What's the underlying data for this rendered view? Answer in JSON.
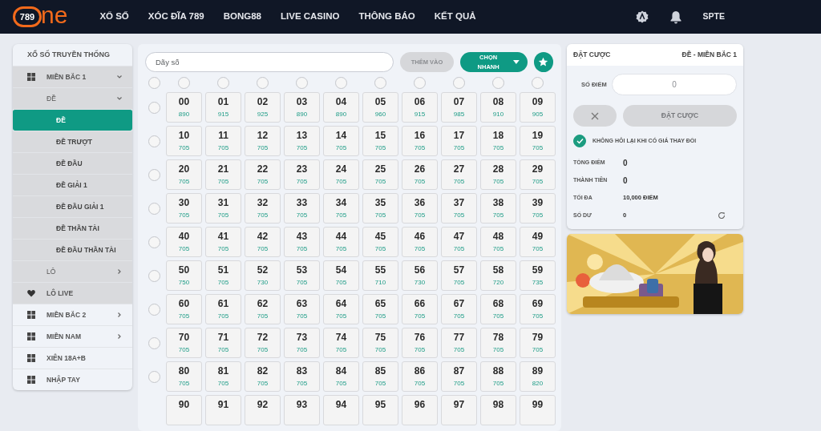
{
  "header": {
    "logo": {
      "number": "789",
      "word": "ne"
    },
    "nav": [
      {
        "label": "XỔ SỐ"
      },
      {
        "label": "XÓC ĐĨA 789"
      },
      {
        "label": "BONG88"
      },
      {
        "label": "LIVE CASINO"
      },
      {
        "label": "THÔNG BÁO"
      },
      {
        "label": "KẾT QUẢ"
      }
    ],
    "username": "SPTE"
  },
  "sidebar": {
    "title": "XỔ SỐ TRUYỀN THỐNG",
    "items": [
      {
        "label": "MIỀN BẮC 1",
        "kind": "region",
        "expanded": true,
        "selected": false,
        "children": [
          {
            "label": "ĐỀ",
            "kind": "group",
            "expanded": true,
            "selected": false,
            "children": [
              {
                "label": "ĐỀ",
                "kind": "leaf",
                "selected": true
              },
              {
                "label": "ĐỀ TRƯỢT",
                "kind": "leaf",
                "selected": false
              },
              {
                "label": "ĐỀ ĐẦU",
                "kind": "leaf",
                "selected": false
              },
              {
                "label": "ĐỀ GIẢI 1",
                "kind": "leaf",
                "selected": false
              },
              {
                "label": "ĐỀ ĐẦU GIẢI 1",
                "kind": "leaf",
                "selected": false
              },
              {
                "label": "ĐỀ THẦN TÀI",
                "kind": "leaf",
                "selected": false
              },
              {
                "label": "ĐỀ ĐẦU THẦN TÀI",
                "kind": "leaf",
                "selected": false
              }
            ]
          },
          {
            "label": "LÔ",
            "kind": "group",
            "expanded": false,
            "selected": false
          },
          {
            "label": "LÔ LIVE",
            "kind": "live",
            "selected": false
          }
        ]
      },
      {
        "label": "MIỀN BẮC 2",
        "kind": "region",
        "expanded": false,
        "selected": false
      },
      {
        "label": "MIỀN NAM",
        "kind": "region",
        "expanded": false,
        "selected": false
      },
      {
        "label": "XIÊN 18A+B",
        "kind": "region",
        "selected": false
      },
      {
        "label": "NHẬP TAY",
        "kind": "region",
        "selected": false
      }
    ]
  },
  "picker": {
    "search": {
      "placeholder": "Dãy số"
    },
    "add_button": {
      "label": "THÊM VÀO",
      "disabled": true
    },
    "quick_button": {
      "label": "CHỌN NHANH"
    },
    "corner_selector": {
      "checked": false
    },
    "column_selectors": [
      {
        "checked": false
      },
      {
        "checked": false
      },
      {
        "checked": false
      },
      {
        "checked": false
      },
      {
        "checked": false
      },
      {
        "checked": false
      },
      {
        "checked": false
      },
      {
        "checked": false
      },
      {
        "checked": false
      },
      {
        "checked": false
      }
    ],
    "rows": [
      {
        "checked": false,
        "tiles": [
          {
            "number": "00",
            "odds": "890",
            "selected": false
          },
          {
            "number": "01",
            "odds": "915",
            "selected": false
          },
          {
            "number": "02",
            "odds": "925",
            "selected": false
          },
          {
            "number": "03",
            "odds": "890",
            "selected": false
          },
          {
            "number": "04",
            "odds": "890",
            "selected": false
          },
          {
            "number": "05",
            "odds": "960",
            "selected": false
          },
          {
            "number": "06",
            "odds": "915",
            "selected": false
          },
          {
            "number": "07",
            "odds": "985",
            "selected": false
          },
          {
            "number": "08",
            "odds": "910",
            "selected": false
          },
          {
            "number": "09",
            "odds": "905",
            "selected": false
          }
        ]
      },
      {
        "checked": false,
        "tiles": [
          {
            "number": "10",
            "odds": "705",
            "selected": false
          },
          {
            "number": "11",
            "odds": "705",
            "selected": false
          },
          {
            "number": "12",
            "odds": "705",
            "selected": false
          },
          {
            "number": "13",
            "odds": "705",
            "selected": false
          },
          {
            "number": "14",
            "odds": "705",
            "selected": false
          },
          {
            "number": "15",
            "odds": "705",
            "selected": false
          },
          {
            "number": "16",
            "odds": "705",
            "selected": false
          },
          {
            "number": "17",
            "odds": "705",
            "selected": false
          },
          {
            "number": "18",
            "odds": "705",
            "selected": false
          },
          {
            "number": "19",
            "odds": "705",
            "selected": false
          }
        ]
      },
      {
        "checked": false,
        "tiles": [
          {
            "number": "20",
            "odds": "705",
            "selected": false
          },
          {
            "number": "21",
            "odds": "705",
            "selected": false
          },
          {
            "number": "22",
            "odds": "705",
            "selected": false
          },
          {
            "number": "23",
            "odds": "705",
            "selected": false
          },
          {
            "number": "24",
            "odds": "705",
            "selected": false
          },
          {
            "number": "25",
            "odds": "705",
            "selected": false
          },
          {
            "number": "26",
            "odds": "705",
            "selected": false
          },
          {
            "number": "27",
            "odds": "705",
            "selected": false
          },
          {
            "number": "28",
            "odds": "705",
            "selected": false
          },
          {
            "number": "29",
            "odds": "705",
            "selected": false
          }
        ]
      },
      {
        "checked": false,
        "tiles": [
          {
            "number": "30",
            "odds": "705",
            "selected": false
          },
          {
            "number": "31",
            "odds": "705",
            "selected": false
          },
          {
            "number": "32",
            "odds": "705",
            "selected": false
          },
          {
            "number": "33",
            "odds": "705",
            "selected": false
          },
          {
            "number": "34",
            "odds": "705",
            "selected": false
          },
          {
            "number": "35",
            "odds": "705",
            "selected": false
          },
          {
            "number": "36",
            "odds": "705",
            "selected": false
          },
          {
            "number": "37",
            "odds": "705",
            "selected": false
          },
          {
            "number": "38",
            "odds": "705",
            "selected": false
          },
          {
            "number": "39",
            "odds": "705",
            "selected": false
          }
        ]
      },
      {
        "checked": false,
        "tiles": [
          {
            "number": "40",
            "odds": "705",
            "selected": false
          },
          {
            "number": "41",
            "odds": "705",
            "selected": false
          },
          {
            "number": "42",
            "odds": "705",
            "selected": false
          },
          {
            "number": "43",
            "odds": "705",
            "selected": false
          },
          {
            "number": "44",
            "odds": "705",
            "selected": false
          },
          {
            "number": "45",
            "odds": "705",
            "selected": false
          },
          {
            "number": "46",
            "odds": "705",
            "selected": false
          },
          {
            "number": "47",
            "odds": "705",
            "selected": false
          },
          {
            "number": "48",
            "odds": "705",
            "selected": false
          },
          {
            "number": "49",
            "odds": "705",
            "selected": false
          }
        ]
      },
      {
        "checked": false,
        "tiles": [
          {
            "number": "50",
            "odds": "750",
            "selected": false
          },
          {
            "number": "51",
            "odds": "705",
            "selected": false
          },
          {
            "number": "52",
            "odds": "730",
            "selected": false
          },
          {
            "number": "53",
            "odds": "705",
            "selected": false
          },
          {
            "number": "54",
            "odds": "705",
            "selected": false
          },
          {
            "number": "55",
            "odds": "710",
            "selected": false
          },
          {
            "number": "56",
            "odds": "730",
            "selected": false
          },
          {
            "number": "57",
            "odds": "705",
            "selected": false
          },
          {
            "number": "58",
            "odds": "720",
            "selected": false
          },
          {
            "number": "59",
            "odds": "735",
            "selected": false
          }
        ]
      },
      {
        "checked": false,
        "tiles": [
          {
            "number": "60",
            "odds": "705",
            "selected": false
          },
          {
            "number": "61",
            "odds": "705",
            "selected": false
          },
          {
            "number": "62",
            "odds": "705",
            "selected": false
          },
          {
            "number": "63",
            "odds": "705",
            "selected": false
          },
          {
            "number": "64",
            "odds": "705",
            "selected": false
          },
          {
            "number": "65",
            "odds": "705",
            "selected": false
          },
          {
            "number": "66",
            "odds": "705",
            "selected": false
          },
          {
            "number": "67",
            "odds": "705",
            "selected": false
          },
          {
            "number": "68",
            "odds": "705",
            "selected": false
          },
          {
            "number": "69",
            "odds": "705",
            "selected": false
          }
        ]
      },
      {
        "checked": false,
        "tiles": [
          {
            "number": "70",
            "odds": "705",
            "selected": false
          },
          {
            "number": "71",
            "odds": "705",
            "selected": false
          },
          {
            "number": "72",
            "odds": "705",
            "selected": false
          },
          {
            "number": "73",
            "odds": "705",
            "selected": false
          },
          {
            "number": "74",
            "odds": "705",
            "selected": false
          },
          {
            "number": "75",
            "odds": "705",
            "selected": false
          },
          {
            "number": "76",
            "odds": "705",
            "selected": false
          },
          {
            "number": "77",
            "odds": "705",
            "selected": false
          },
          {
            "number": "78",
            "odds": "705",
            "selected": false
          },
          {
            "number": "79",
            "odds": "705",
            "selected": false
          }
        ]
      },
      {
        "checked": false,
        "tiles": [
          {
            "number": "80",
            "odds": "705",
            "selected": false
          },
          {
            "number": "81",
            "odds": "705",
            "selected": false
          },
          {
            "number": "82",
            "odds": "705",
            "selected": false
          },
          {
            "number": "83",
            "odds": "705",
            "selected": false
          },
          {
            "number": "84",
            "odds": "705",
            "selected": false
          },
          {
            "number": "85",
            "odds": "705",
            "selected": false
          },
          {
            "number": "86",
            "odds": "705",
            "selected": false
          },
          {
            "number": "87",
            "odds": "705",
            "selected": false
          },
          {
            "number": "88",
            "odds": "705",
            "selected": false
          },
          {
            "number": "89",
            "odds": "820",
            "selected": false
          }
        ]
      },
      {
        "tiles": [
          {
            "number": "90",
            "selected": false
          },
          {
            "number": "91",
            "selected": false
          },
          {
            "number": "92",
            "selected": false
          },
          {
            "number": "93",
            "selected": false
          },
          {
            "number": "94",
            "selected": false
          },
          {
            "number": "95",
            "selected": false
          },
          {
            "number": "96",
            "selected": false
          },
          {
            "number": "97",
            "selected": false
          },
          {
            "number": "98",
            "selected": false
          },
          {
            "number": "99",
            "selected": false
          }
        ]
      }
    ]
  },
  "bet_panel": {
    "title": "ĐẶT CƯỢC",
    "subtitle": "ĐỀ - MIỀN BẮC 1",
    "points_label": "SỐ ĐIỂM",
    "points_field": {
      "placeholder": "0"
    },
    "clear_button": {
      "disabled": true
    },
    "submit_button": {
      "label": "ĐẶT CƯỢC",
      "disabled": true
    },
    "no_confirm": {
      "label": "KHÔNG HỎI LẠI KHI CÓ GIÁ THAY ĐỔI",
      "checked": true
    },
    "summary": [
      {
        "label": "TỔNG ĐIỂM",
        "value": "0",
        "kind": "large"
      },
      {
        "label": "THÀNH TIỀN",
        "value": "0",
        "kind": "large"
      },
      {
        "label": "TỐI ĐA",
        "value": "10,000 ĐIỂM",
        "kind": "small"
      },
      {
        "label": "SỐ DƯ",
        "value": "0",
        "kind": "balance"
      }
    ]
  }
}
